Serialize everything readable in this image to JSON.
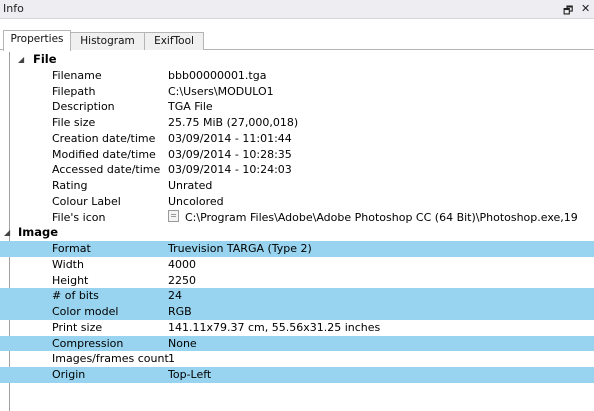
{
  "panel": {
    "title": "Info",
    "restore_glyph": "🗗",
    "close_glyph": "✕"
  },
  "tabs": [
    {
      "label": "Properties",
      "active": true
    },
    {
      "label": "Histogram",
      "active": false
    },
    {
      "label": "ExifTool",
      "active": false
    }
  ],
  "file": {
    "label": "File",
    "rows": [
      {
        "name": "Filename",
        "value": "bbb00000001.tga"
      },
      {
        "name": "Filepath",
        "value": "C:\\Users\\MODULO1"
      },
      {
        "name": "Description",
        "value": "TGA File"
      },
      {
        "name": "File size",
        "value": "25.75 MiB (27,000,018)"
      },
      {
        "name": "Creation date/time",
        "value": "03/09/2014 - 11:01:44"
      },
      {
        "name": "Modified date/time",
        "value": "03/09/2014 - 10:28:35"
      },
      {
        "name": "Accessed date/time",
        "value": "03/09/2014 - 10:24:03"
      },
      {
        "name": "Rating",
        "value": "Unrated"
      },
      {
        "name": "Colour Label",
        "value": "Uncolored"
      },
      {
        "name": "File's icon",
        "value": "C:\\Program Files\\Adobe\\Adobe Photoshop CC (64 Bit)\\Photoshop.exe,19"
      }
    ]
  },
  "image": {
    "label": "Image",
    "rows": [
      {
        "name": "Format",
        "value": "Truevision TARGA (Type 2)"
      },
      {
        "name": "Width",
        "value": "4000"
      },
      {
        "name": "Height",
        "value": "2250"
      },
      {
        "name": "# of bits",
        "value": "24"
      },
      {
        "name": "Color model",
        "value": "RGB"
      },
      {
        "name": "Print size",
        "value": "141.11x79.37 cm, 55.56x31.25 inches"
      },
      {
        "name": "Compression",
        "value": "None"
      },
      {
        "name": "Images/frames count",
        "value": "1"
      },
      {
        "name": "Origin",
        "value": "Top-Left"
      }
    ]
  },
  "colors": {
    "highlight": "#98d4ef",
    "titlebar": "#eeeef2"
  }
}
